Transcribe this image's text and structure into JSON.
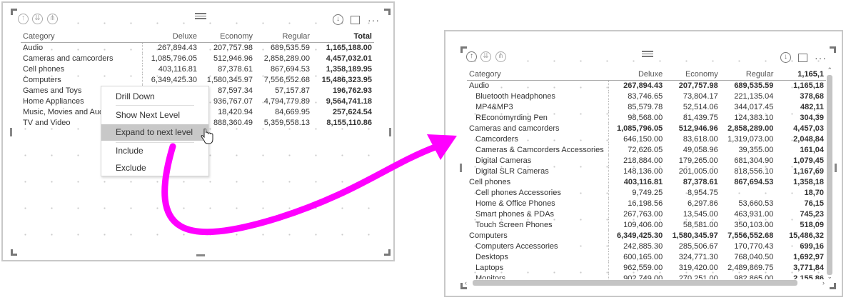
{
  "left": {
    "headers": {
      "category": "Category",
      "deluxe": "Deluxe",
      "economy": "Economy",
      "regular": "Regular",
      "total": "Total"
    },
    "rows": [
      {
        "category": "Audio",
        "deluxe": "267,894.43",
        "economy": "207,757.98",
        "regular": "689,535.59",
        "total": "1,165,188.00"
      },
      {
        "category": "Cameras and camcorders",
        "deluxe": "1,085,796.05",
        "economy": "512,946.96",
        "regular": "2,858,289.00",
        "total": "4,457,032.01"
      },
      {
        "category": "Cell phones",
        "deluxe": "403,116.81",
        "economy": "87,378.61",
        "regular": "867,694.53",
        "total": "1,358,189.95"
      },
      {
        "category": "Computers",
        "deluxe": "6,349,425.30",
        "economy": "1,580,345.97",
        "regular": "7,556,552.68",
        "total": "15,486,323.95"
      },
      {
        "category": "Games and Toys",
        "deluxe": "",
        "economy": "87,597.34",
        "regular": "57,157.87",
        "total": "196,762.93"
      },
      {
        "category": "Home Appliances",
        "deluxe": "",
        "economy": "936,767.07",
        "regular": "4,794,779.89",
        "total": "9,564,741.18"
      },
      {
        "category": "Music, Movies and Audio Books",
        "deluxe": "",
        "economy": "18,420.94",
        "regular": "84,669.95",
        "total": "257,624.54"
      },
      {
        "category": "TV and Video",
        "deluxe": "",
        "economy": "888,360.49",
        "regular": "5,359,558.13",
        "total": "8,155,110.86"
      }
    ],
    "context_menu": {
      "drill_down": "Drill Down",
      "show_next_level": "Show Next Level",
      "expand_next_level": "Expand to next level",
      "include": "Include",
      "exclude": "Exclude"
    },
    "header_icons": [
      "drill-up-icon",
      "drill-down-icon",
      "expand-all-down-icon",
      "drill-mode-icon",
      "focus-mode-icon",
      "more-options-icon"
    ]
  },
  "right": {
    "headers": {
      "category": "Category",
      "deluxe": "Deluxe",
      "economy": "Economy",
      "regular": "Regular",
      "total": "1,165,1"
    },
    "rows": [
      {
        "category": "Audio",
        "level": 0,
        "deluxe": "267,894.43",
        "economy": "207,757.98",
        "regular": "689,535.59",
        "total": "1,165,18"
      },
      {
        "category": "Bluetooth Headphones",
        "level": 1,
        "deluxe": "83,746.65",
        "economy": "73,804.17",
        "regular": "221,135.04",
        "total": "378,68"
      },
      {
        "category": "MP4&MP3",
        "level": 1,
        "deluxe": "85,579.78",
        "economy": "52,514.06",
        "regular": "344,017.45",
        "total": "482,11"
      },
      {
        "category": "REconomyrding Pen",
        "level": 1,
        "deluxe": "98,568.00",
        "economy": "81,439.75",
        "regular": "124,383.10",
        "total": "304,39"
      },
      {
        "category": "Cameras and camcorders",
        "level": 0,
        "deluxe": "1,085,796.05",
        "economy": "512,946.96",
        "regular": "2,858,289.00",
        "total": "4,457,03"
      },
      {
        "category": "Camcorders",
        "level": 1,
        "deluxe": "646,150.00",
        "economy": "83,618.00",
        "regular": "1,319,073.00",
        "total": "2,048,84"
      },
      {
        "category": "Cameras & Camcorders Accessories",
        "level": 1,
        "deluxe": "72,626.05",
        "economy": "49,058.96",
        "regular": "39,355.00",
        "total": "161,04"
      },
      {
        "category": "Digital Cameras",
        "level": 1,
        "deluxe": "218,884.00",
        "economy": "179,265.00",
        "regular": "681,304.90",
        "total": "1,079,45"
      },
      {
        "category": "Digital SLR Cameras",
        "level": 1,
        "deluxe": "148,136.00",
        "economy": "201,005.00",
        "regular": "818,556.10",
        "total": "1,167,69"
      },
      {
        "category": "Cell phones",
        "level": 0,
        "deluxe": "403,116.81",
        "economy": "87,378.61",
        "regular": "867,694.53",
        "total": "1,358,18"
      },
      {
        "category": "Cell phones Accessories",
        "level": 1,
        "deluxe": "9,749.25",
        "economy": "8,954.75",
        "regular": "",
        "total": "18,70"
      },
      {
        "category": "Home & Office Phones",
        "level": 1,
        "deluxe": "16,198.56",
        "economy": "6,297.86",
        "regular": "53,660.53",
        "total": "76,15"
      },
      {
        "category": "Smart phones & PDAs",
        "level": 1,
        "deluxe": "267,763.00",
        "economy": "13,545.00",
        "regular": "463,931.00",
        "total": "745,23"
      },
      {
        "category": "Touch Screen Phones",
        "level": 1,
        "deluxe": "109,406.00",
        "economy": "58,581.00",
        "regular": "350,103.00",
        "total": "518,09"
      },
      {
        "category": "Computers",
        "level": 0,
        "deluxe": "6,349,425.30",
        "economy": "1,580,345.97",
        "regular": "7,556,552.68",
        "total": "15,486,32"
      },
      {
        "category": "Computers Accessories",
        "level": 1,
        "deluxe": "242,885.30",
        "economy": "285,506.67",
        "regular": "170,770.43",
        "total": "699,16"
      },
      {
        "category": "Desktops",
        "level": 1,
        "deluxe": "600,165.00",
        "economy": "324,771.30",
        "regular": "768,040.50",
        "total": "1,692,97"
      },
      {
        "category": "Laptops",
        "level": 1,
        "deluxe": "962,559.00",
        "economy": "319,420.00",
        "regular": "2,489,869.75",
        "total": "3,771,84"
      },
      {
        "category": "Monitors",
        "level": 1,
        "deluxe": "902,749.00",
        "economy": "270,251.00",
        "regular": "982,865.00",
        "total": "2,155,86"
      }
    ]
  },
  "colors": {
    "arrow": "#ff00ff",
    "highlight": "#c8c8c8"
  }
}
